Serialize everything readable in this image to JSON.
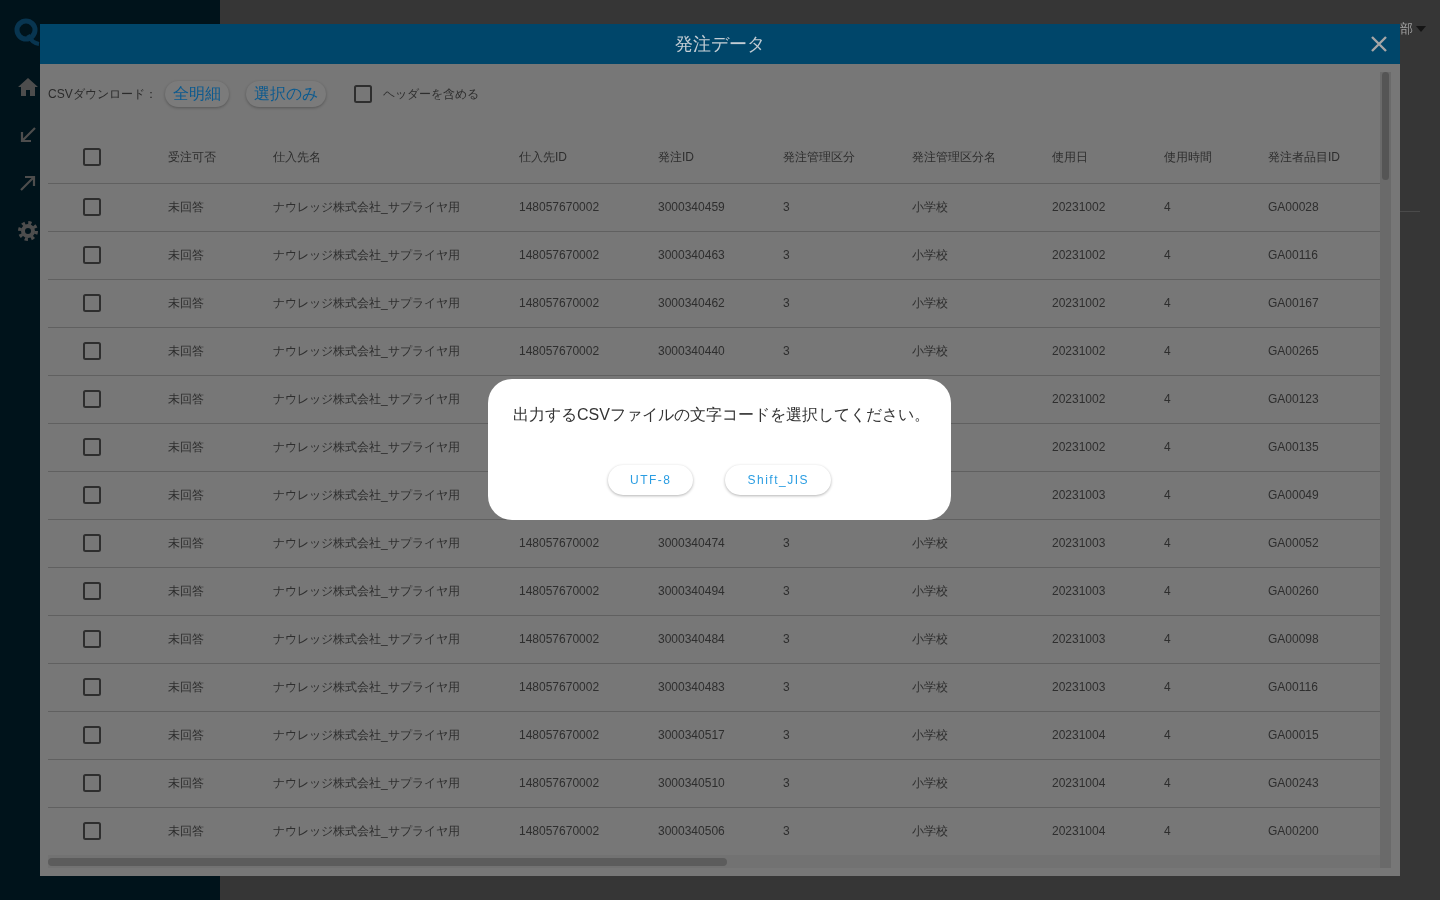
{
  "header": {
    "user": "部"
  },
  "modal": {
    "title": "発注データ",
    "toolbar": {
      "label": "CSVダウンロード：",
      "buttons": [
        "全明細",
        "選択のみ"
      ],
      "include_header": {
        "label": "ヘッダーを含める",
        "checked": false
      }
    }
  },
  "table": {
    "select_all": {
      "checked": false
    },
    "columns": [
      "受注可否",
      "仕入先名",
      "仕入先ID",
      "発注ID",
      "発注管理区分",
      "発注管理区分名",
      "使用日",
      "使用時間",
      "発注者品目ID"
    ],
    "rows": [
      {
        "checked": false,
        "acceptance": "未回答",
        "supplier_name": "ナウレッジ株式会社_サプライヤ用",
        "supplier_id": "148057670002",
        "order_id": "3000340459",
        "order_class": "3",
        "order_class_name": "小学校",
        "use_date": "20231002",
        "use_hours": "4",
        "item_id": "GA00028"
      },
      {
        "checked": false,
        "acceptance": "未回答",
        "supplier_name": "ナウレッジ株式会社_サプライヤ用",
        "supplier_id": "148057670002",
        "order_id": "3000340463",
        "order_class": "3",
        "order_class_name": "小学校",
        "use_date": "20231002",
        "use_hours": "4",
        "item_id": "GA00116"
      },
      {
        "checked": false,
        "acceptance": "未回答",
        "supplier_name": "ナウレッジ株式会社_サプライヤ用",
        "supplier_id": "148057670002",
        "order_id": "3000340462",
        "order_class": "3",
        "order_class_name": "小学校",
        "use_date": "20231002",
        "use_hours": "4",
        "item_id": "GA00167"
      },
      {
        "checked": false,
        "acceptance": "未回答",
        "supplier_name": "ナウレッジ株式会社_サプライヤ用",
        "supplier_id": "148057670002",
        "order_id": "3000340440",
        "order_class": "3",
        "order_class_name": "小学校",
        "use_date": "20231002",
        "use_hours": "4",
        "item_id": "GA00265"
      },
      {
        "checked": false,
        "acceptance": "未回答",
        "supplier_name": "ナウレッジ株式会社_サプライヤ用",
        "use_date": "20231002",
        "use_hours": "4",
        "item_id": "GA00123"
      },
      {
        "checked": false,
        "acceptance": "未回答",
        "supplier_name": "ナウレッジ株式会社_サプライヤ用",
        "use_date": "20231002",
        "use_hours": "4",
        "item_id": "GA00135"
      },
      {
        "checked": false,
        "acceptance": "未回答",
        "supplier_name": "ナウレッジ株式会社_サプライヤ用",
        "use_date": "20231003",
        "use_hours": "4",
        "item_id": "GA00049"
      },
      {
        "checked": false,
        "acceptance": "未回答",
        "supplier_name": "ナウレッジ株式会社_サプライヤ用",
        "supplier_id": "148057670002",
        "order_id": "3000340474",
        "order_class": "3",
        "order_class_name": "小学校",
        "use_date": "20231003",
        "use_hours": "4",
        "item_id": "GA00052"
      },
      {
        "checked": false,
        "acceptance": "未回答",
        "supplier_name": "ナウレッジ株式会社_サプライヤ用",
        "supplier_id": "148057670002",
        "order_id": "3000340494",
        "order_class": "3",
        "order_class_name": "小学校",
        "use_date": "20231003",
        "use_hours": "4",
        "item_id": "GA00260"
      },
      {
        "checked": false,
        "acceptance": "未回答",
        "supplier_name": "ナウレッジ株式会社_サプライヤ用",
        "supplier_id": "148057670002",
        "order_id": "3000340484",
        "order_class": "3",
        "order_class_name": "小学校",
        "use_date": "20231003",
        "use_hours": "4",
        "item_id": "GA00098"
      },
      {
        "checked": false,
        "acceptance": "未回答",
        "supplier_name": "ナウレッジ株式会社_サプライヤ用",
        "supplier_id": "148057670002",
        "order_id": "3000340483",
        "order_class": "3",
        "order_class_name": "小学校",
        "use_date": "20231003",
        "use_hours": "4",
        "item_id": "GA00116"
      },
      {
        "checked": false,
        "acceptance": "未回答",
        "supplier_name": "ナウレッジ株式会社_サプライヤ用",
        "supplier_id": "148057670002",
        "order_id": "3000340517",
        "order_class": "3",
        "order_class_name": "小学校",
        "use_date": "20231004",
        "use_hours": "4",
        "item_id": "GA00015"
      },
      {
        "checked": false,
        "acceptance": "未回答",
        "supplier_name": "ナウレッジ株式会社_サプライヤ用",
        "supplier_id": "148057670002",
        "order_id": "3000340510",
        "order_class": "3",
        "order_class_name": "小学校",
        "use_date": "20231004",
        "use_hours": "4",
        "item_id": "GA00243"
      },
      {
        "checked": false,
        "acceptance": "未回答",
        "supplier_name": "ナウレッジ株式会社_サプライヤ用",
        "supplier_id": "148057670002",
        "order_id": "3000340506",
        "order_class": "3",
        "order_class_name": "小学校",
        "use_date": "20231004",
        "use_hours": "4",
        "item_id": "GA00200"
      }
    ]
  },
  "dialog": {
    "message": "出力するCSVファイルの文字コードを選択してください。",
    "buttons": [
      "UTF-8",
      "Shift_JIS"
    ]
  }
}
